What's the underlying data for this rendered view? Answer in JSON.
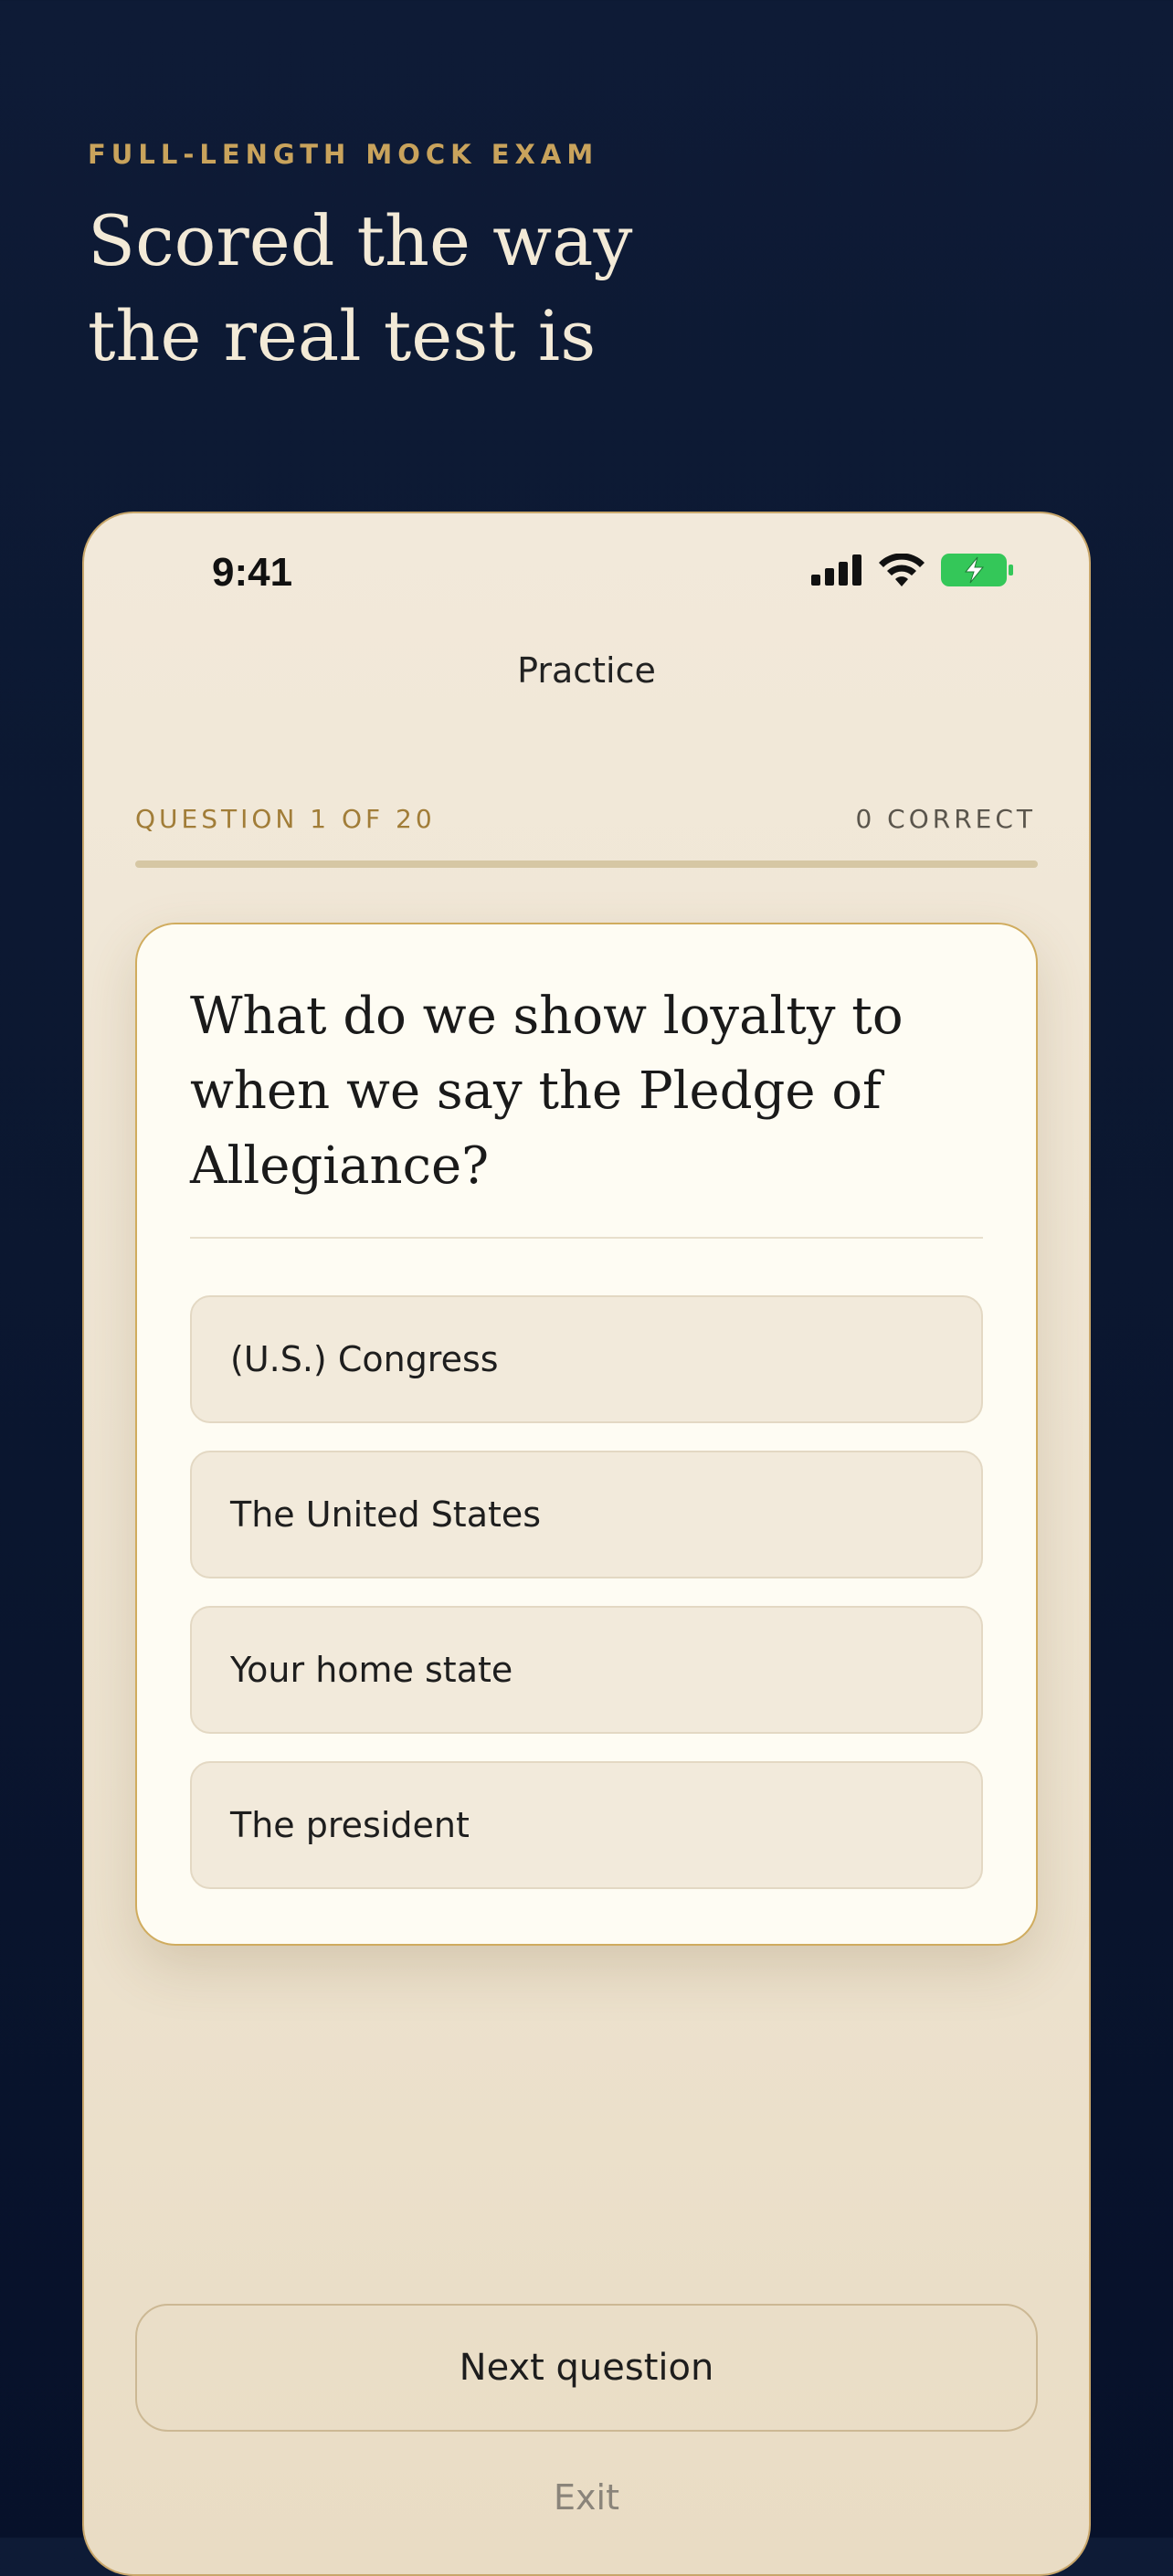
{
  "hero": {
    "eyebrow": "FULL-LENGTH MOCK EXAM",
    "headline_line1": "Scored the way",
    "headline_line2": "the real test is"
  },
  "status_bar": {
    "time": "9:41",
    "icons": [
      "cellular-signal-icon",
      "wifi-icon",
      "battery-charging-icon"
    ],
    "battery_color": "#34c759"
  },
  "nav": {
    "title": "Practice"
  },
  "progress": {
    "question_label": "QUESTION 1 OF 20",
    "correct_label": "0 CORRECT",
    "fraction": 0.0
  },
  "question": {
    "text": "What do we show loyalty to when we say the Pledge of Allegiance?",
    "options": [
      "(U.S.) Congress",
      "The United States",
      "Your home state",
      "The president"
    ]
  },
  "actions": {
    "next_label": "Next question",
    "exit_label": "Exit"
  },
  "colors": {
    "background_navy": "#0e1b36",
    "accent_gold": "#c9a35c",
    "card_background": "#fefcf3",
    "option_background": "#f2eadb"
  }
}
